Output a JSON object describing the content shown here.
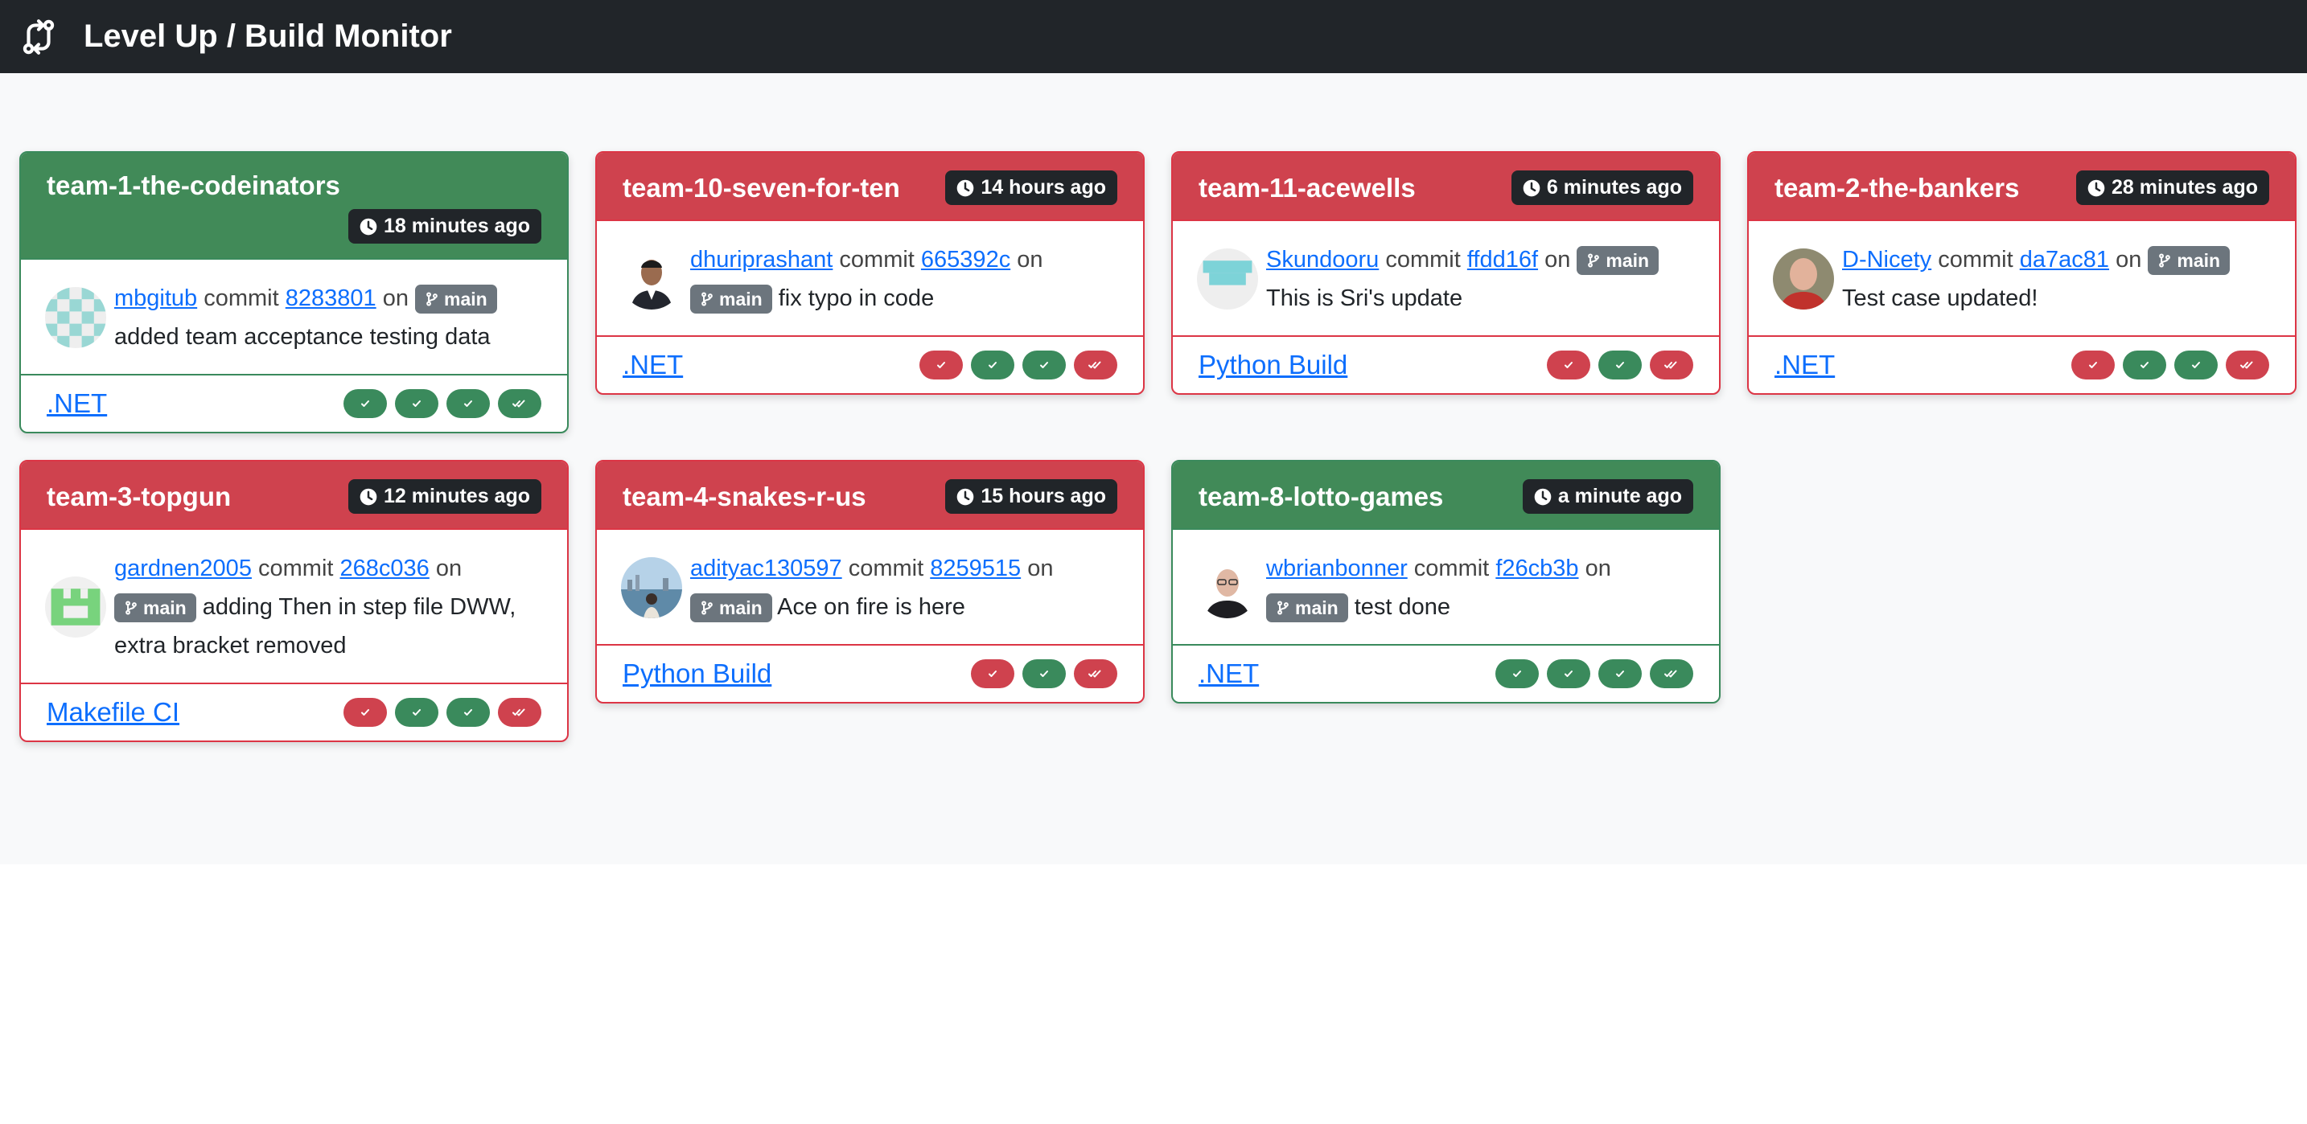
{
  "app": {
    "title": "Level Up / Build Monitor"
  },
  "colors": {
    "success": "#3a8a5c",
    "failure": "#cf424e",
    "navbar": "#212529",
    "link": "#0d6efd"
  },
  "cards": [
    {
      "team": "team-1-the-codeinators",
      "status": "success",
      "time": "18 minutes ago",
      "user": "mbgitub",
      "commit_word": "commit",
      "sha": "8283801",
      "on_word": "on",
      "branch": "main",
      "message": "added team acceptance testing data",
      "workflow": ".NET",
      "avatar": "identicon-teal",
      "runs": [
        "success",
        "success",
        "success",
        "success-all"
      ]
    },
    {
      "team": "team-10-seven-for-ten",
      "status": "failure",
      "time": "14 hours ago",
      "user": "dhuriprashant",
      "commit_word": "commit",
      "sha": "665392c",
      "on_word": "on",
      "branch": "main",
      "message": "fix typo in code",
      "workflow": ".NET",
      "avatar": "photo-man",
      "runs": [
        "failure",
        "success",
        "success",
        "failure-all"
      ]
    },
    {
      "team": "team-11-acewells",
      "status": "failure",
      "time": "6 minutes ago",
      "user": "Skundooru",
      "commit_word": "commit",
      "sha": "ffdd16f",
      "on_word": "on",
      "branch": "main",
      "message": "This is Sri's update",
      "workflow": "Python Build",
      "avatar": "identicon-cyan",
      "runs": [
        "failure",
        "success",
        "failure-all"
      ]
    },
    {
      "team": "team-2-the-bankers",
      "status": "failure",
      "time": "28 minutes ago",
      "user": "D-Nicety",
      "commit_word": "commit",
      "sha": "da7ac81",
      "on_word": "on",
      "branch": "main",
      "message": "Test case updated!",
      "workflow": ".NET",
      "avatar": "photo-bald",
      "runs": [
        "failure",
        "success",
        "success",
        "failure-all"
      ]
    },
    {
      "team": "team-3-topgun",
      "status": "failure",
      "time": "12 minutes ago",
      "user": "gardnen2005",
      "commit_word": "commit",
      "sha": "268c036",
      "on_word": "on",
      "branch": "main",
      "message": "adding Then in step file DWW, extra bracket removed",
      "workflow": "Makefile CI",
      "avatar": "identicon-green",
      "runs": [
        "failure",
        "success",
        "success",
        "failure-all"
      ]
    },
    {
      "team": "team-4-snakes-r-us",
      "status": "failure",
      "time": "15 hours ago",
      "user": "adityac130597",
      "commit_word": "commit",
      "sha": "8259515",
      "on_word": "on",
      "branch": "main",
      "message": "Ace on fire is here",
      "workflow": "Python Build",
      "avatar": "photo-landscape",
      "runs": [
        "failure",
        "success",
        "failure-all"
      ]
    },
    {
      "team": "team-8-lotto-games",
      "status": "success",
      "time": "a minute ago",
      "user": "wbrianbonner",
      "commit_word": "commit",
      "sha": "f26cb3b",
      "on_word": "on",
      "branch": "main",
      "message": "test done",
      "workflow": ".NET",
      "avatar": "photo-glasses",
      "runs": [
        "success",
        "success",
        "success",
        "success-all"
      ]
    }
  ]
}
